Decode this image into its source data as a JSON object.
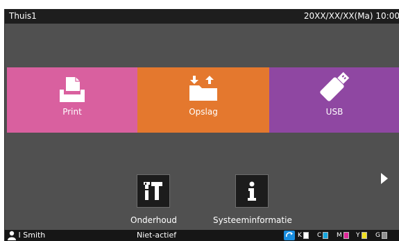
{
  "header": {
    "title": "Thuis1",
    "datetime": "20XX/XX/XX(Ma) 10:00"
  },
  "tiles": [
    {
      "label": "Print",
      "icon": "print-icon",
      "color": "#d9609f"
    },
    {
      "label": "Opslag",
      "icon": "storage-folder-icon",
      "color": "#e4782e"
    },
    {
      "label": "USB",
      "icon": "usb-icon",
      "color": "#8f47a2"
    }
  ],
  "functions": [
    {
      "label": "Onderhoud",
      "icon": "maintenance-tools-icon"
    },
    {
      "label": "Systeeminformatie",
      "icon": "info-icon"
    }
  ],
  "status": {
    "user": "I Smith",
    "state": "Niet-actief",
    "inks": [
      {
        "label": "K",
        "color": "#222222"
      },
      {
        "label": "C",
        "color": "#18a8e0"
      },
      {
        "label": "M",
        "color": "#e0289a"
      },
      {
        "label": "Y",
        "color": "#f0e020"
      },
      {
        "label": "G",
        "color": "#909090"
      }
    ]
  }
}
